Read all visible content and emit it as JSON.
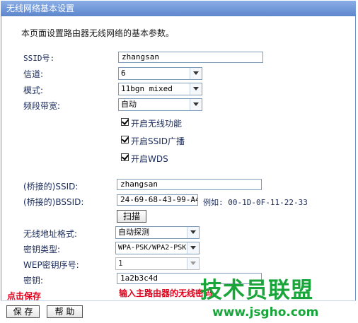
{
  "window": {
    "title": "无线网络基本设置"
  },
  "intro": "本页面设置路由器无线网络的基本参数。",
  "form": {
    "ssid": {
      "label": "SSID号:",
      "value": "zhangsan"
    },
    "channel": {
      "label": "信道:",
      "value": "6"
    },
    "mode": {
      "label": "模式:",
      "value": "11bgn mixed"
    },
    "bandwidth": {
      "label": "频段带宽:",
      "value": "自动"
    },
    "enable_wireless": {
      "label": "开启无线功能",
      "checked": true
    },
    "enable_ssid_broadcast": {
      "label": "开启SSID广播",
      "checked": true
    },
    "enable_wds": {
      "label": "开启WDS",
      "checked": true
    }
  },
  "wds": {
    "bridge_ssid": {
      "label": "(桥接的)SSID:",
      "value": "zhangsan"
    },
    "bridge_bssid": {
      "label": "(桥接的)BSSID:",
      "value": "24-69-68-43-99-A4",
      "example": "例如: 00-1D-0F-11-22-33"
    },
    "scan_button": "扫描",
    "address_format": {
      "label": "无线地址格式:",
      "value": "自动探测"
    },
    "key_type": {
      "label": "密钥类型:",
      "value": "WPA-PSK/WPA2-PSK"
    },
    "wep_index": {
      "label": "WEP密钥序号:",
      "value": "1"
    },
    "key": {
      "label": "密钥:",
      "value": "1a2b3c4d"
    }
  },
  "annotations": {
    "click_save": "点击保存",
    "enter_password": "输入主路由器的无线密码"
  },
  "buttons": {
    "save": "保 存",
    "help": "帮 助"
  },
  "watermark": {
    "title": "技术员联盟",
    "url": "www.jsgho.com"
  },
  "colors": {
    "titlebar": "#6f93d6",
    "annotation": "#e0001b",
    "watermark": "#1aa53b"
  }
}
